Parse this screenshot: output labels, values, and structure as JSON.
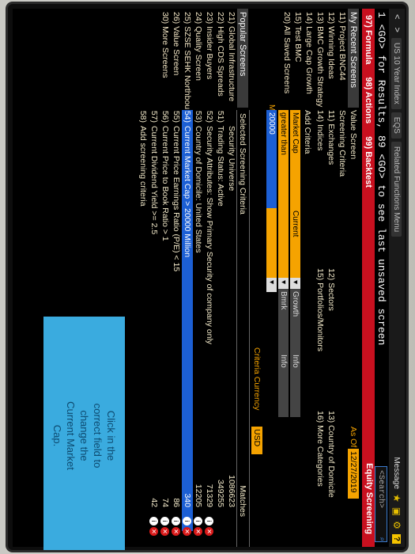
{
  "nav": {
    "back": "<",
    "forward": ">",
    "crumbs": [
      "US 10 Year Index",
      "EQS",
      "Related Functions Menu"
    ],
    "message": "Message",
    "help": "?"
  },
  "cmdline": {
    "text": "1 <GO> for Results, 89 <GO> to see last unsaved screen",
    "search_placeholder": "<Search>"
  },
  "redbar": {
    "formula": "97) Formula",
    "actions": "98) Actions",
    "backtest": "99) Backtest",
    "title": "Equity Screening"
  },
  "left": {
    "my_recent": "My Recent Screens",
    "recent": [
      "11) Project BNC44",
      "12) Winning Ideas",
      "13) BMC Growth Strategy",
      "14) Large Cap Growth",
      "15) Test BMC",
      "20) All Saved Screens"
    ],
    "popular": "Popular Screens",
    "popular_items": [
      "21) Global Infrastructure",
      "22) High CDS Spreads",
      "23) Insider Buyers",
      "24) Quality Screen",
      "25) SZSE SEHK Northbou..",
      "26) Value Screen",
      "30) More Screens"
    ]
  },
  "mid": {
    "value_screen": "Value Screen",
    "as_of_label": "As Of",
    "as_of": "12/27/2019",
    "screening_criteria": "Screening Criteria",
    "exchanges": "11) Exchanges",
    "sectors": "12) Sectors",
    "country": "13) Country of Domicile",
    "indices": "14) Indices",
    "portfolios": "15) Portfolios/Monitors",
    "more_categories": "16) More Categories",
    "add_criteria": "Add Criteria",
    "market_cap": "Market Cap",
    "current": "Current",
    "growth": "Growth",
    "info": "Info",
    "greater_than": "greater than",
    "bmrk": "Bmrk",
    "m": "M",
    "value_input": "20000",
    "criteria_currency": "Criteria Currency",
    "currency": "USD"
  },
  "selected": {
    "header": "Selected Screening Criteria",
    "matches": "Matches",
    "rows": [
      {
        "n": "",
        "label": "Security Universe",
        "count": "1086623"
      },
      {
        "n": "51)",
        "label": "Trading Status: Active",
        "count": "349255"
      },
      {
        "n": "52)",
        "label": "Security Attributes: Show Primary Security of company only",
        "count": "71329"
      },
      {
        "n": "53)",
        "label": "Country of Domicile: United States",
        "count": "12205"
      },
      {
        "n": "54)",
        "label": "Current Market Cap > 20000 Million",
        "count": "340"
      },
      {
        "n": "55)",
        "label": "Current Price Earnings Ratio (P/E) < 15",
        "count": "86"
      },
      {
        "n": "56)",
        "label": "Current Price to Book Ratio > 1",
        "count": "74"
      },
      {
        "n": "57)",
        "label": "Current Dividend Yield >= 2.5",
        "count": "42"
      },
      {
        "n": "58)",
        "label": "Add screening criteria",
        "count": ""
      }
    ]
  },
  "tooltip": {
    "text": "Click in the correct field to change the Current Market Cap."
  },
  "colors": {
    "red": "#c8101f",
    "orange": "#f5a300",
    "blue": "#1c5fd4",
    "tooltip": "#3aabdf"
  }
}
